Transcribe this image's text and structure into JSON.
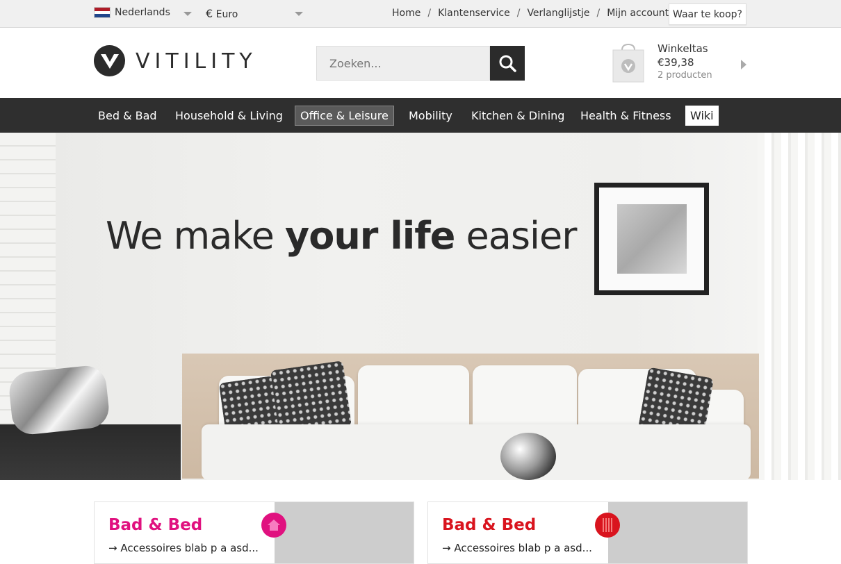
{
  "topbar": {
    "language": "Nederlands",
    "currency_symbol": "€",
    "currency": "Euro",
    "links": [
      "Home",
      "Klantenservice",
      "Verlanglijstje",
      "Mijn account"
    ],
    "link_separator": "/",
    "store_button": "Waar te koop?"
  },
  "header": {
    "logo_text": "VITILITY",
    "search_placeholder": "Zoeken...",
    "cart": {
      "title": "Winkeltas",
      "total": "€39,38",
      "count": "2 producten"
    }
  },
  "nav": {
    "items": [
      "Bed & Bad",
      "Household & Living",
      "Office & Leisure",
      "Mobility",
      "Kitchen & Dining",
      "Health & Fitness",
      "Wiki"
    ],
    "active": "Office & Leisure"
  },
  "hero": {
    "headline_part1": "We make ",
    "headline_bold": "your life",
    "headline_part2": " easier"
  },
  "cards": [
    {
      "title": "Bad & Bed",
      "link": "→ Accessoires blab p a asd...",
      "accent": "#e0117f",
      "icon": "home-icon"
    },
    {
      "title": "Bad & Bed",
      "link": "→ Accessoires blab p a asd...",
      "accent": "#d9141e",
      "icon": "cutlery-icon"
    }
  ],
  "colors": {
    "nav_bg": "#2f2f2f",
    "dark": "#2b2b2b"
  }
}
